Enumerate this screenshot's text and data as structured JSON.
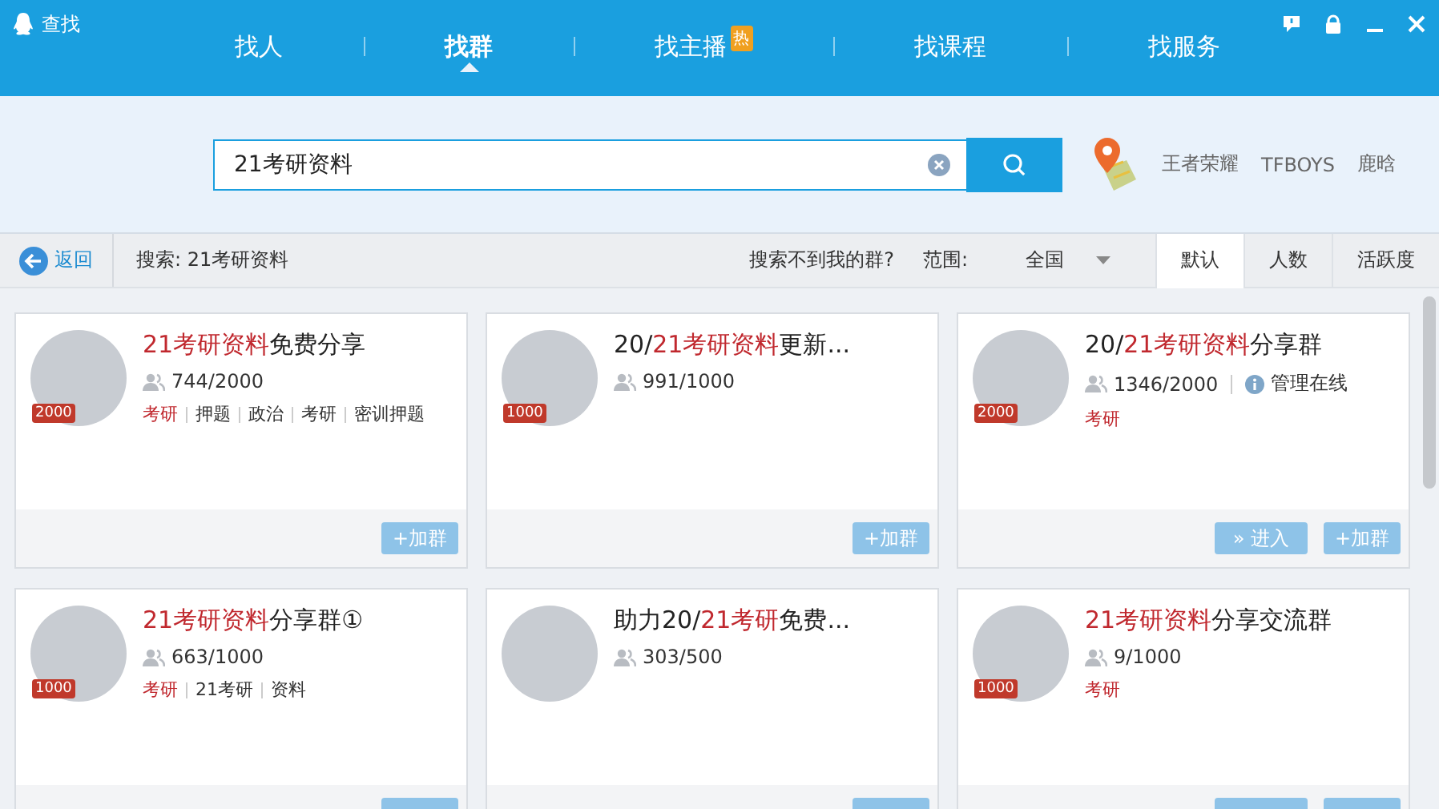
{
  "window": {
    "title": "查找"
  },
  "nav_tabs": [
    {
      "label": "找人",
      "selected": false
    },
    {
      "label": "找群",
      "selected": true
    },
    {
      "label": "找主播",
      "selected": false,
      "badge": "热"
    },
    {
      "label": "找课程",
      "selected": false
    },
    {
      "label": "找服务",
      "selected": false
    }
  ],
  "search": {
    "value": "21考研资料"
  },
  "hot_words": [
    "王者荣耀",
    "TFBOYS",
    "鹿晗"
  ],
  "filter_bar": {
    "back": "返回",
    "query": "搜索: 21考研资料",
    "help_link": "搜索不到我的群?",
    "range_label": "范围:",
    "range_value": "全国",
    "sort_tabs": [
      {
        "label": "默认",
        "selected": true
      },
      {
        "label": "人数",
        "selected": false
      },
      {
        "label": "活跃度",
        "selected": false
      }
    ]
  },
  "groups": [
    {
      "title": [
        {
          "text": "21考研资料",
          "highlight": true
        },
        {
          "text": "免费分享",
          "highlight": false
        }
      ],
      "capacity_badge": "2000",
      "members": "744/2000",
      "tags": [
        {
          "text": "考研",
          "highlight": true
        },
        {
          "text": "押题",
          "highlight": false
        },
        {
          "text": "政治",
          "highlight": false
        },
        {
          "text": "考研",
          "highlight": false
        },
        {
          "text": "密训押题",
          "highlight": false
        }
      ],
      "buttons": [
        {
          "kind": "join",
          "label": "+加群"
        }
      ]
    },
    {
      "title": [
        {
          "text": "20/",
          "highlight": false
        },
        {
          "text": "21考研资料",
          "highlight": true
        },
        {
          "text": "更新...",
          "highlight": false
        }
      ],
      "capacity_badge": "1000",
      "members": "991/1000",
      "buttons": [
        {
          "kind": "join",
          "label": "+加群"
        }
      ]
    },
    {
      "title": [
        {
          "text": "20/",
          "highlight": false
        },
        {
          "text": "21考研资料",
          "highlight": true
        },
        {
          "text": "分享群",
          "highlight": false
        }
      ],
      "capacity_badge": "2000",
      "members": "1346/2000",
      "status": "管理在线",
      "tags": [
        {
          "text": "考研",
          "highlight": true
        }
      ],
      "buttons": [
        {
          "kind": "enter",
          "label": "» 进入"
        },
        {
          "kind": "join",
          "label": "+加群"
        }
      ]
    },
    {
      "title": [
        {
          "text": "21考研资料",
          "highlight": true
        },
        {
          "text": "分享群①",
          "highlight": false
        }
      ],
      "capacity_badge": "1000",
      "members": "663/1000",
      "tags": [
        {
          "text": "考研",
          "highlight": true
        },
        {
          "text": "21考研",
          "highlight": false
        },
        {
          "text": "资料",
          "highlight": false
        }
      ],
      "buttons": [
        {
          "kind": "join"
        }
      ]
    },
    {
      "title": [
        {
          "text": "助力20/",
          "highlight": false
        },
        {
          "text": "21考研",
          "highlight": true
        },
        {
          "text": "免费...",
          "highlight": false
        }
      ],
      "members": "303/500",
      "buttons": [
        {
          "kind": "join"
        }
      ]
    },
    {
      "title": [
        {
          "text": "21考研资料",
          "highlight": true
        },
        {
          "text": "分享交流群",
          "highlight": false
        }
      ],
      "capacity_badge": "1000",
      "members": "9/1000",
      "tags": [
        {
          "text": "考研",
          "highlight": true
        }
      ],
      "buttons": [
        {
          "kind": "enter"
        },
        {
          "kind": "join"
        }
      ]
    }
  ]
}
